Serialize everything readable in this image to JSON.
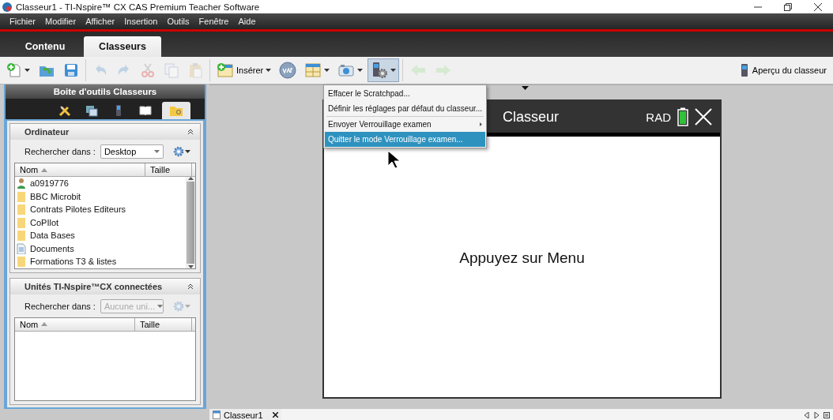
{
  "window": {
    "title": "Classeur1 - TI-Nspire™ CX CAS Premium Teacher Software"
  },
  "menu_bar": [
    "Fichier",
    "Modifier",
    "Afficher",
    "Insertion",
    "Outils",
    "Fenêtre",
    "Aide"
  ],
  "tabs": [
    {
      "label": "Contenu",
      "selected": false
    },
    {
      "label": "Classeurs",
      "selected": true
    }
  ],
  "toolbar": {
    "buttons": [
      {
        "kind": "new",
        "caret": true,
        "disabled": false,
        "pressed": false
      },
      {
        "kind": "open",
        "caret": false,
        "disabled": false,
        "pressed": false
      },
      {
        "kind": "save",
        "caret": false,
        "disabled": false,
        "pressed": false
      },
      {
        "kind": "undo",
        "caret": false,
        "disabled": true,
        "pressed": false
      },
      {
        "kind": "redo",
        "caret": false,
        "disabled": true,
        "pressed": false
      },
      {
        "kind": "cut",
        "caret": false,
        "disabled": true,
        "pressed": false
      },
      {
        "kind": "copy",
        "caret": false,
        "disabled": true,
        "pressed": false
      },
      {
        "kind": "paste",
        "caret": false,
        "disabled": true,
        "pressed": false
      },
      {
        "kind": "insert",
        "label": "Insérer",
        "caret": true,
        "disabled": false,
        "pressed": false
      },
      {
        "kind": "var",
        "caret": false,
        "disabled": false,
        "pressed": false
      },
      {
        "kind": "layout",
        "caret": true,
        "disabled": false,
        "pressed": false
      },
      {
        "kind": "camera",
        "caret": true,
        "disabled": false,
        "pressed": false
      },
      {
        "kind": "device",
        "caret": true,
        "disabled": false,
        "pressed": true
      },
      {
        "kind": "back",
        "caret": false,
        "disabled": true,
        "pressed": false
      },
      {
        "kind": "forward",
        "caret": false,
        "disabled": true,
        "pressed": false
      }
    ],
    "preview_label": "Aperçu du classeur"
  },
  "toolbox": {
    "title": "Boite d'outils Classeurs",
    "tabs": [
      {
        "kind": "tools",
        "selected": false
      },
      {
        "kind": "pages",
        "selected": false
      },
      {
        "kind": "device",
        "selected": false
      },
      {
        "kind": "book",
        "selected": false
      },
      {
        "kind": "browser",
        "selected": true
      }
    ],
    "panels": [
      {
        "title": "Ordinateur",
        "search_label": "Rechercher dans :",
        "location": "Desktop",
        "disabled": false,
        "columns": [
          "Nom",
          "Taille"
        ],
        "files": [
          {
            "name": "a0919776",
            "kind": "user"
          },
          {
            "name": "BBC Microbit",
            "kind": "folder"
          },
          {
            "name": "Contrats Pilotes Editeurs",
            "kind": "folder"
          },
          {
            "name": "CoPIlot",
            "kind": "folder"
          },
          {
            "name": "Data Bases",
            "kind": "folder"
          },
          {
            "name": "Documents",
            "kind": "document"
          },
          {
            "name": "Formations T3 & listes",
            "kind": "folder"
          }
        ]
      },
      {
        "title": "Unités TI-Nspire™CX connectées",
        "search_label": "Rechercher dans :",
        "location": "Aucune uni...",
        "disabled": true,
        "columns": [
          "Nom",
          "Taille"
        ]
      }
    ]
  },
  "device": {
    "title": "Classeur",
    "mode": "RAD",
    "message": "Appuyez sur Menu"
  },
  "context_menu": [
    {
      "label": "Effacer le Scratchpad...",
      "selected": false,
      "submenu": false,
      "divider_above": false
    },
    {
      "label": "Définir les réglages par défaut du classeur...",
      "selected": false,
      "submenu": false,
      "divider_above": false
    },
    {
      "label": "Envoyer Verrouillage examen",
      "selected": false,
      "submenu": true,
      "divider_above": true
    },
    {
      "label": "Quitter le mode Verrouillage examen...",
      "selected": true,
      "submenu": false,
      "divider_above": false
    }
  ],
  "document_tabs": [
    {
      "label": "Classeur1"
    }
  ]
}
